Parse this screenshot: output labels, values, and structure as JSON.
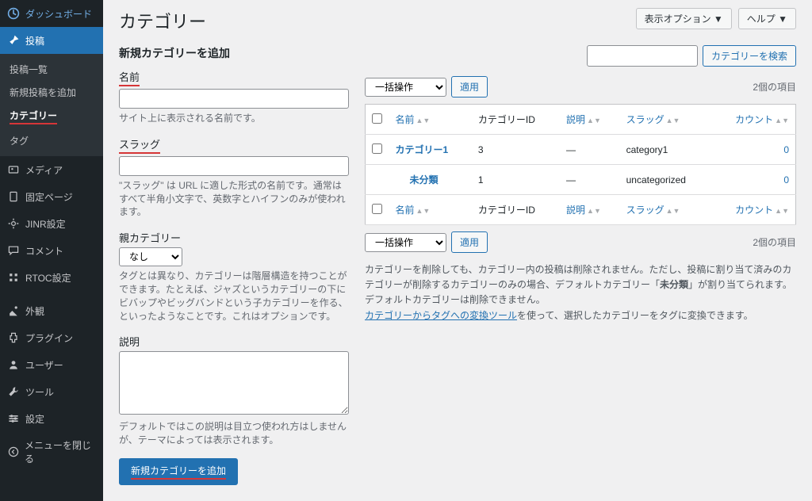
{
  "sidebar": {
    "items": [
      {
        "icon": "dashboard",
        "label": "ダッシュボード"
      },
      {
        "icon": "pin",
        "label": "投稿"
      },
      {
        "icon": "media",
        "label": "メディア"
      },
      {
        "icon": "page",
        "label": "固定ページ"
      },
      {
        "icon": "gear",
        "label": "JINR設定"
      },
      {
        "icon": "comment",
        "label": "コメント"
      },
      {
        "icon": "gear",
        "label": "RTOC設定"
      },
      {
        "icon": "appearance",
        "label": "外観"
      },
      {
        "icon": "plugin",
        "label": "プラグイン"
      },
      {
        "icon": "user",
        "label": "ユーザー"
      },
      {
        "icon": "tool",
        "label": "ツール"
      },
      {
        "icon": "settings",
        "label": "設定"
      },
      {
        "icon": "collapse",
        "label": "メニューを閉じる"
      }
    ],
    "submenu": [
      {
        "label": "投稿一覧"
      },
      {
        "label": "新規投稿を追加"
      },
      {
        "label": "カテゴリー"
      },
      {
        "label": "タグ"
      }
    ]
  },
  "header": {
    "title": "カテゴリー",
    "screen_options": "表示オプション ▼",
    "help": "ヘルプ ▼"
  },
  "search": {
    "button": "カテゴリーを検索"
  },
  "form": {
    "heading": "新規カテゴリーを追加",
    "name_label": "名前",
    "name_help": "サイト上に表示される名前です。",
    "slug_label": "スラッグ",
    "slug_help": "\"スラッグ\" は URL に適した形式の名前です。通常はすべて半角小文字で、英数字とハイフンのみが使われます。",
    "parent_label": "親カテゴリー",
    "parent_option": "なし",
    "parent_help": "タグとは異なり、カテゴリーは階層構造を持つことができます。たとえば、ジャズというカテゴリーの下にビバップやビッグバンドという子カテゴリーを作る、といったようなことです。これはオプションです。",
    "desc_label": "説明",
    "desc_help": "デフォルトではこの説明は目立つ使われ方はしませんが、テーマによっては表示されます。",
    "submit": "新規カテゴリーを追加"
  },
  "bulk": {
    "select": "一括操作",
    "apply": "適用"
  },
  "table": {
    "count": "2個の項目",
    "cols": {
      "name": "名前",
      "id": "カテゴリーID",
      "desc": "説明",
      "slug": "スラッグ",
      "count": "カウント"
    },
    "rows": [
      {
        "name": "カテゴリー1",
        "id": "3",
        "desc": "—",
        "slug": "category1",
        "count": "0"
      },
      {
        "name": "未分類",
        "id": "1",
        "desc": "—",
        "slug": "uncategorized",
        "count": "0"
      }
    ]
  },
  "footer_note": {
    "line1a": "カテゴリーを削除しても、カテゴリー内の投稿は削除されません。ただし、投稿に割り当て済みのカテゴリーが削除するカテゴリーのみの場合、デフォルトカテゴリー「",
    "bold": "未分類",
    "line1b": "」が割り当てられます。デフォルトカテゴリーは削除できません。",
    "link": "カテゴリーからタグへの変換ツール",
    "line2": "を使って、選択したカテゴリーをタグに変換できます。"
  }
}
